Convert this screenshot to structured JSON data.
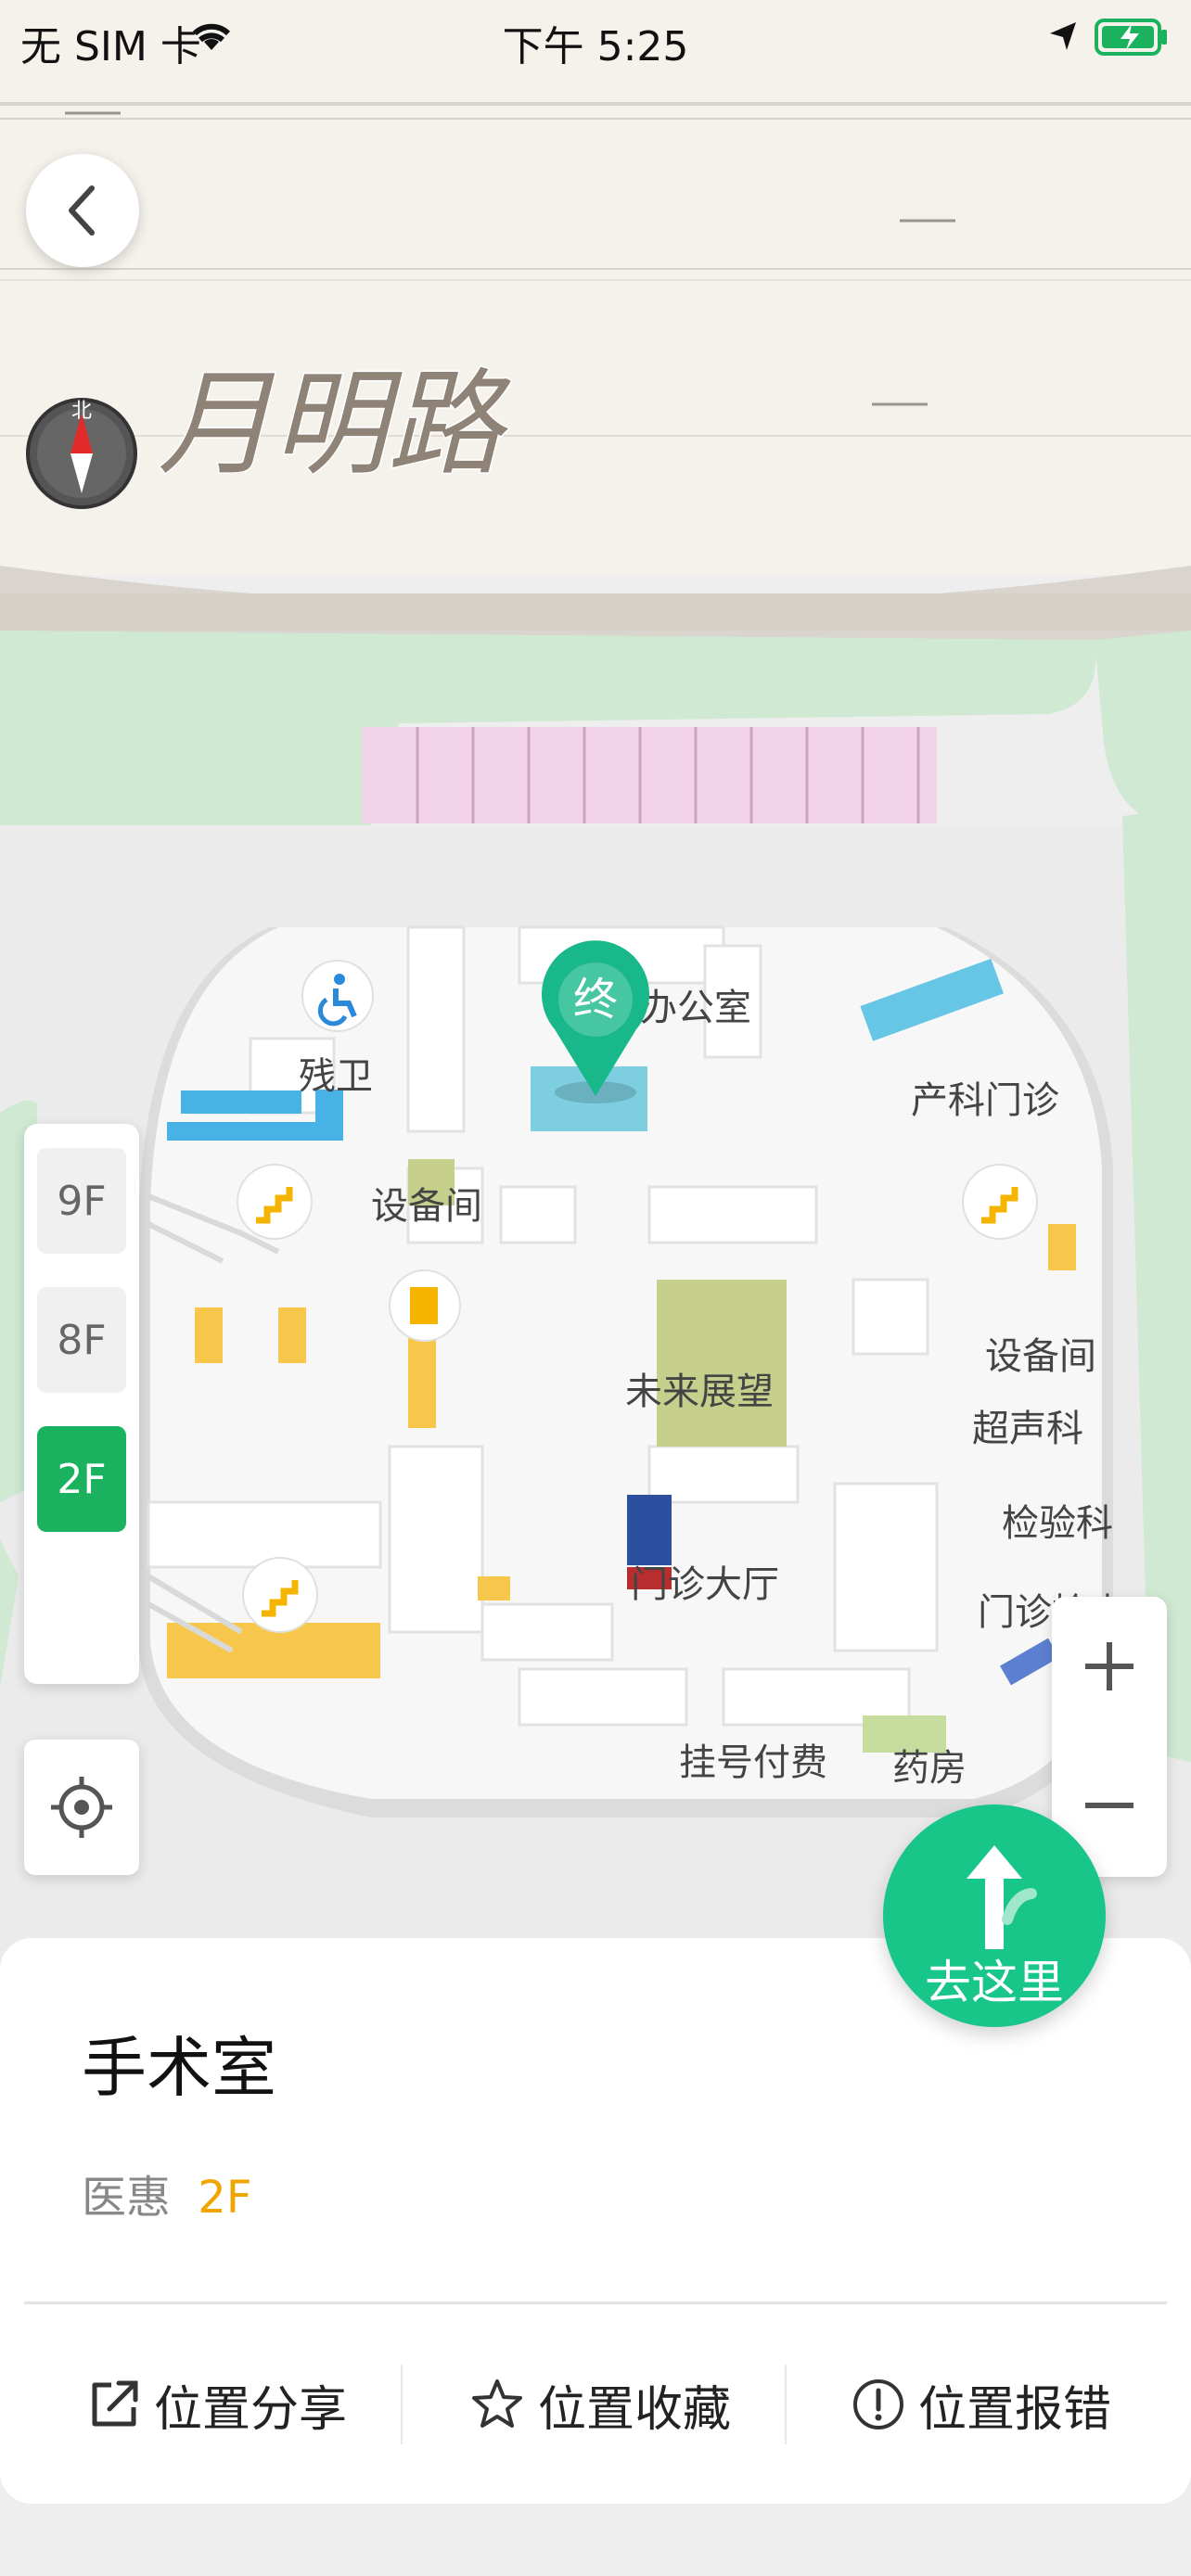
{
  "status_bar": {
    "carrier": "无 SIM 卡",
    "time": "下午 5:25"
  },
  "map": {
    "road_name": "月明路",
    "compass_label": "北",
    "end_marker_label": "终",
    "labels": [
      "办公室",
      "残卫",
      "产科门诊",
      "设备间",
      "设备间",
      "未来展望",
      "超声科",
      "检验科",
      "门诊大厅",
      "门诊检查",
      "挂号付费",
      "药房"
    ]
  },
  "floors": {
    "items": [
      "9F",
      "8F",
      "2F"
    ],
    "active": "2F"
  },
  "go_button": {
    "label": "去这里"
  },
  "place": {
    "title": "手术室",
    "building": "医惠",
    "floor": "2F"
  },
  "actions": {
    "share": "位置分享",
    "favorite": "位置收藏",
    "report": "位置报错"
  },
  "colors": {
    "accent_green": "#1bb25f",
    "go_green": "#19c68a",
    "floor_yellow": "#f0a500"
  }
}
